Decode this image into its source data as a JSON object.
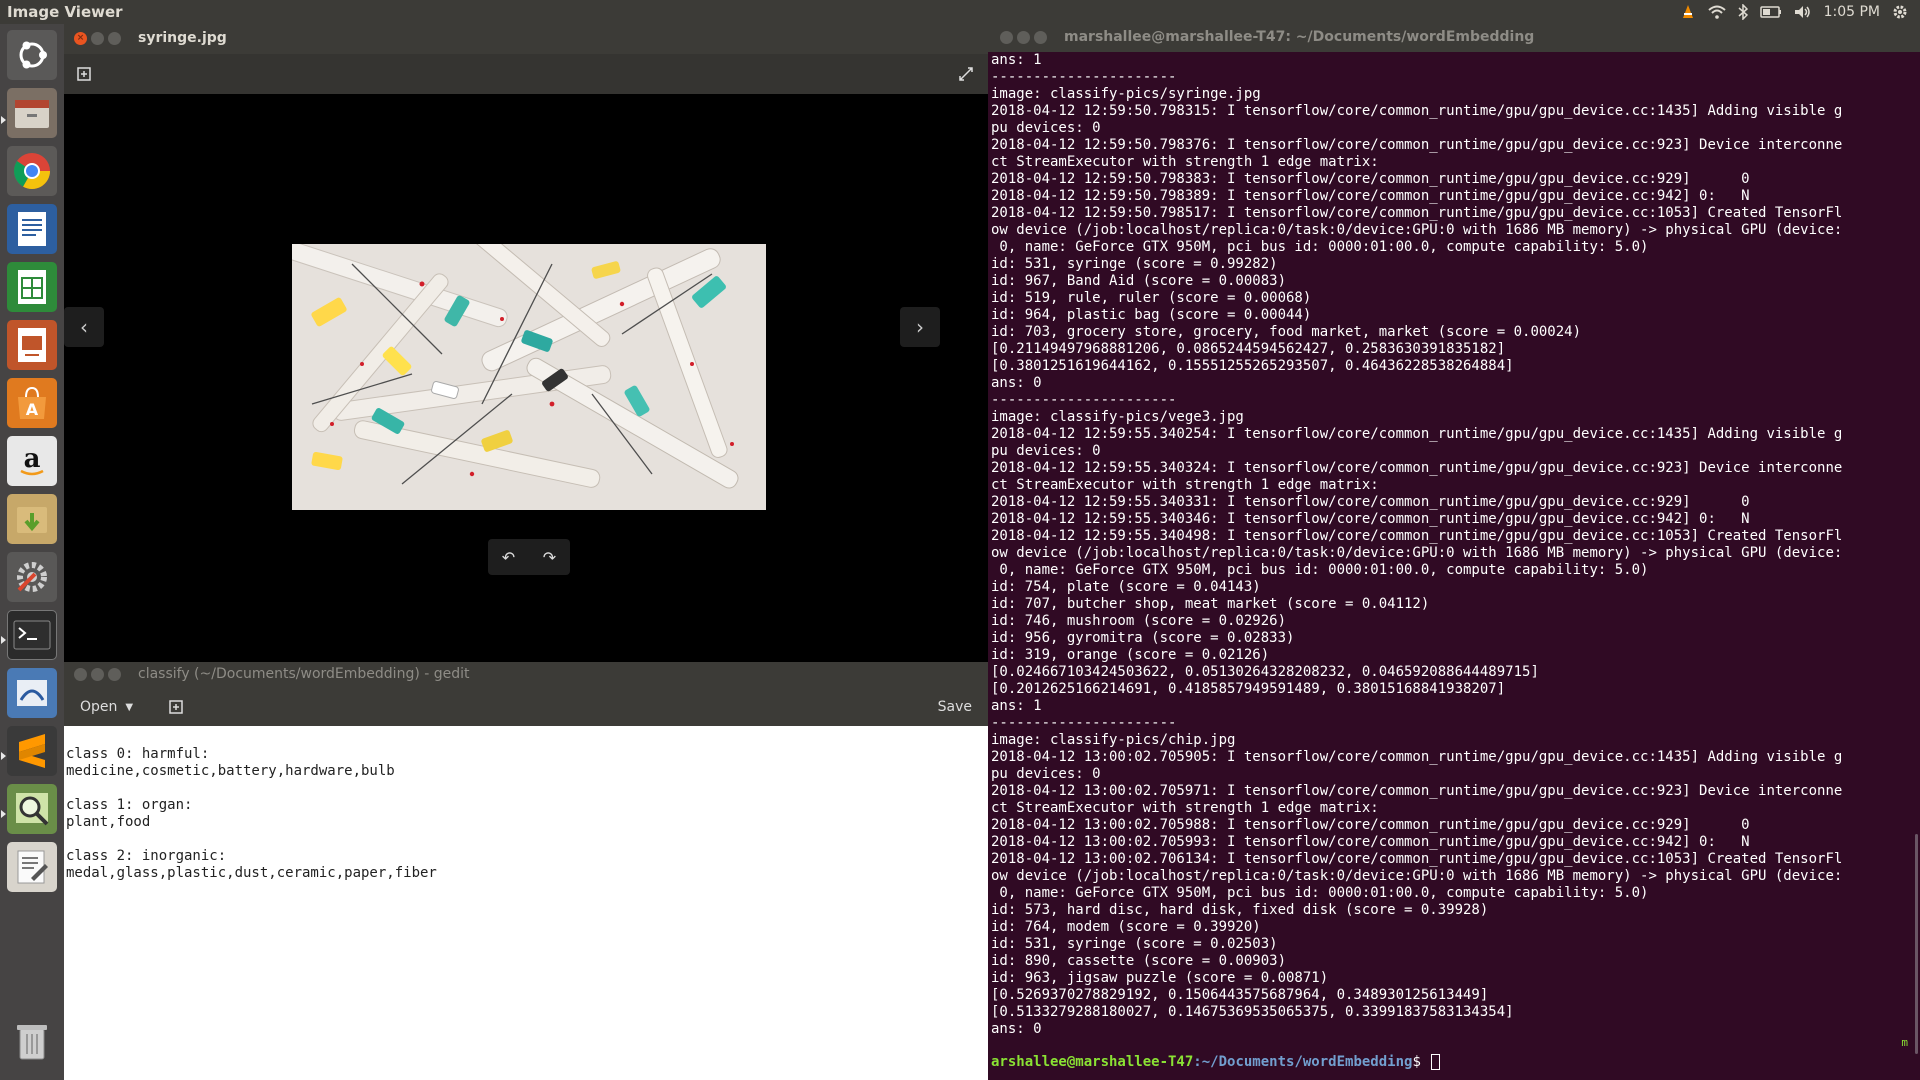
{
  "topbar": {
    "app_name": "Image Viewer",
    "clock": "1:05 PM",
    "tray_icons": [
      "vlc-icon",
      "wifi-icon",
      "bluetooth-icon",
      "battery-icon",
      "volume-icon",
      "settings-gear-icon"
    ]
  },
  "launcher": {
    "items": [
      {
        "name": "ubuntu-dash-icon"
      },
      {
        "name": "files-icon"
      },
      {
        "name": "chrome-icon"
      },
      {
        "name": "writer-icon"
      },
      {
        "name": "calc-icon"
      },
      {
        "name": "impress-icon"
      },
      {
        "name": "software-center-icon"
      },
      {
        "name": "amazon-icon"
      },
      {
        "name": "archive-icon"
      },
      {
        "name": "system-settings-icon"
      },
      {
        "name": "terminal-icon"
      },
      {
        "name": "document-viewer-icon"
      },
      {
        "name": "sublime-text-icon"
      },
      {
        "name": "image-viewer-icon"
      },
      {
        "name": "gedit-icon"
      },
      {
        "name": "trash-icon"
      }
    ]
  },
  "viewer": {
    "title": "syringe.jpg"
  },
  "gedit": {
    "title": "classify (~/Documents/wordEmbedding) - gedit",
    "open_label": "Open",
    "save_label": "Save",
    "text": "class 0: harmful:\nmedicine,cosmetic,battery,hardware,bulb\n\nclass 1: organ:\nplant,food\n\nclass 2: inorganic:\nmedal,glass,plastic,dust,ceramic,paper,fiber"
  },
  "terminal": {
    "title": "marshallee@marshallee-T47: ~/Documents/wordEmbedding",
    "output": "ans: 1\n----------------------\nimage: classify-pics/syringe.jpg\n2018-04-12 12:59:50.798315: I tensorflow/core/common_runtime/gpu/gpu_device.cc:1435] Adding visible g\npu devices: 0\n2018-04-12 12:59:50.798376: I tensorflow/core/common_runtime/gpu/gpu_device.cc:923] Device interconne\nct StreamExecutor with strength 1 edge matrix:\n2018-04-12 12:59:50.798383: I tensorflow/core/common_runtime/gpu/gpu_device.cc:929]      0\n2018-04-12 12:59:50.798389: I tensorflow/core/common_runtime/gpu/gpu_device.cc:942] 0:   N\n2018-04-12 12:59:50.798517: I tensorflow/core/common_runtime/gpu/gpu_device.cc:1053] Created TensorFl\now device (/job:localhost/replica:0/task:0/device:GPU:0 with 1686 MB memory) -> physical GPU (device:\n 0, name: GeForce GTX 950M, pci bus id: 0000:01:00.0, compute capability: 5.0)\nid: 531, syringe (score = 0.99282)\nid: 967, Band Aid (score = 0.00083)\nid: 519, rule, ruler (score = 0.00068)\nid: 964, plastic bag (score = 0.00044)\nid: 703, grocery store, grocery, food market, market (score = 0.00024)\n[0.21149497968881206, 0.0865244594562427, 0.2583630391835182]\n[0.3801251619644162, 0.15551255265293507, 0.46436228538264884]\nans: 0\n----------------------\nimage: classify-pics/vege3.jpg\n2018-04-12 12:59:55.340254: I tensorflow/core/common_runtime/gpu/gpu_device.cc:1435] Adding visible g\npu devices: 0\n2018-04-12 12:59:55.340324: I tensorflow/core/common_runtime/gpu/gpu_device.cc:923] Device interconne\nct StreamExecutor with strength 1 edge matrix:\n2018-04-12 12:59:55.340331: I tensorflow/core/common_runtime/gpu/gpu_device.cc:929]      0\n2018-04-12 12:59:55.340346: I tensorflow/core/common_runtime/gpu/gpu_device.cc:942] 0:   N\n2018-04-12 12:59:55.340498: I tensorflow/core/common_runtime/gpu/gpu_device.cc:1053] Created TensorFl\now device (/job:localhost/replica:0/task:0/device:GPU:0 with 1686 MB memory) -> physical GPU (device:\n 0, name: GeForce GTX 950M, pci bus id: 0000:01:00.0, compute capability: 5.0)\nid: 754, plate (score = 0.04143)\nid: 707, butcher shop, meat market (score = 0.04112)\nid: 746, mushroom (score = 0.02926)\nid: 956, gyromitra (score = 0.02833)\nid: 319, orange (score = 0.02126)\n[0.024667103424503622, 0.05130264328208232, 0.046592088644489715]\n[0.2012625166214691, 0.4185857949591489, 0.38015168841938207]\nans: 1\n----------------------\nimage: classify-pics/chip.jpg\n2018-04-12 13:00:02.705905: I tensorflow/core/common_runtime/gpu/gpu_device.cc:1435] Adding visible g\npu devices: 0\n2018-04-12 13:00:02.705971: I tensorflow/core/common_runtime/gpu/gpu_device.cc:923] Device interconne\nct StreamExecutor with strength 1 edge matrix:\n2018-04-12 13:00:02.705988: I tensorflow/core/common_runtime/gpu/gpu_device.cc:929]      0\n2018-04-12 13:00:02.705993: I tensorflow/core/common_runtime/gpu/gpu_device.cc:942] 0:   N\n2018-04-12 13:00:02.706134: I tensorflow/core/common_runtime/gpu/gpu_device.cc:1053] Created TensorFl\now device (/job:localhost/replica:0/task:0/device:GPU:0 with 1686 MB memory) -> physical GPU (device:\n 0, name: GeForce GTX 950M, pci bus id: 0000:01:00.0, compute capability: 5.0)\nid: 573, hard disc, hard disk, fixed disk (score = 0.39928)\nid: 764, modem (score = 0.39920)\nid: 531, syringe (score = 0.02503)\nid: 890, cassette (score = 0.00903)\nid: 963, jigsaw puzzle (score = 0.00871)\n[0.5269370278829192, 0.1506443575687964, 0.348930125613449]\n[0.5133279288180027, 0.14675369535065375, 0.33991837583134354]\nans: 0",
    "prompt_userhost": "arshallee@marshallee-T47",
    "prompt_path": ":~/Documents/wordEmbedding",
    "prompt_dollar": "$ ",
    "badge": "m"
  },
  "colors": {
    "ubuntu_orange": "#e95420",
    "panel_bg": "#3c3b37",
    "terminal_bg": "#300a24",
    "prompt_green": "#8ae234",
    "prompt_blue": "#729fcf"
  }
}
